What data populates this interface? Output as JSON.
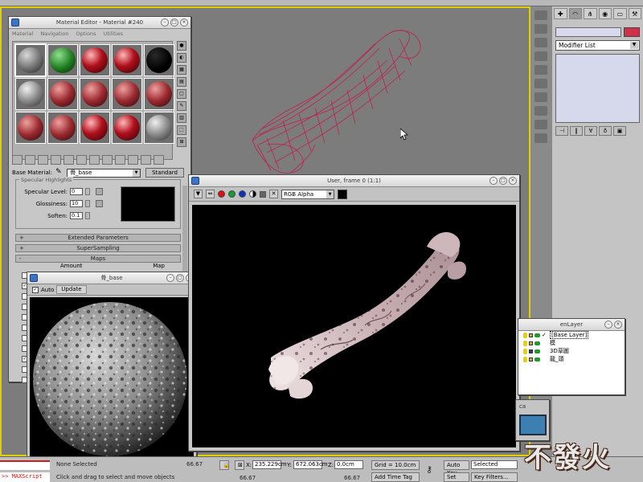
{
  "material_editor": {
    "title": "Material Editor - Material #240",
    "menu": [
      "Material",
      "Navigation",
      "Options",
      "Utilities"
    ],
    "base_material_label": "Base Material:",
    "material_name": "骨_base",
    "material_type": "Standard",
    "specular_group_title": "Specular Highlights",
    "specular_level_label": "Specular Level:",
    "specular_level_value": "0",
    "glossiness_label": "Glossiness:",
    "glossiness_value": "10",
    "soften_label": "Soften:",
    "soften_value": "0.1",
    "rollouts": [
      {
        "sign": "+",
        "label": "Extended Parameters"
      },
      {
        "sign": "+",
        "label": "SuperSampling"
      },
      {
        "sign": "-",
        "label": "Maps"
      }
    ],
    "maps_headers": [
      "Amount",
      "Map"
    ],
    "slots": [
      {
        "style": "stone-grey"
      },
      {
        "style": "green-noise"
      },
      {
        "style": "red-glossy"
      },
      {
        "style": "red-glossy"
      },
      {
        "style": "black"
      },
      {
        "style": "grey-glossy"
      },
      {
        "style": "red-textured"
      },
      {
        "style": "red-textured"
      },
      {
        "style": "red-textured"
      },
      {
        "style": "red-textured"
      },
      {
        "style": "red-textured"
      },
      {
        "style": "red-textured"
      },
      {
        "style": "red-glossy"
      },
      {
        "style": "red-glossy"
      },
      {
        "style": "grey-glossy"
      }
    ]
  },
  "preview_window": {
    "title": "骨_base",
    "auto_label": "Auto",
    "update_label": "Update"
  },
  "render_window": {
    "title": "User, frame 0 (1:1)",
    "channel_select": "RGB Alpha"
  },
  "command_panel": {
    "modifier_list": "Modifier List",
    "object_color": "#d0314a"
  },
  "layer_window": {
    "title": "enLayer",
    "layers": [
      {
        "name": "[Base Layer]",
        "checked": true,
        "lock_color": "yellow"
      },
      {
        "name": "模",
        "checked": false,
        "lock_color": "yellow"
      },
      {
        "name": "3D草圖",
        "checked": false,
        "lock_color": "blue"
      },
      {
        "name": "龍_頭",
        "checked": false,
        "lock_color": "yellow"
      }
    ]
  },
  "small_window": {
    "label": "ca"
  },
  "status_bar": {
    "maxscript": ">> MAXScript",
    "selection": "None Selected",
    "prompt": "Click and drag to select and move objects",
    "x_label": "X:",
    "x_value": "235.229cm",
    "y_label": "Y:",
    "y_value": "672.063cm",
    "z_label": "Z:",
    "z_value": "0.0cm",
    "grid": "Grid = 10.0cm",
    "add_time_tag": "Add Time Tag",
    "auto_key": "Auto Key",
    "selected_dropdown": "Selected",
    "set_key": "Set Key",
    "key_filters": "Key Filters...",
    "time_left": "66.67",
    "time_mid": "66.67",
    "time_right": "66.67"
  },
  "watermark": "不發火",
  "colors": {
    "viewport_border": "#e0d000",
    "mesh_wire": "#c0204a",
    "bone_tint": "#d8c8c8"
  }
}
